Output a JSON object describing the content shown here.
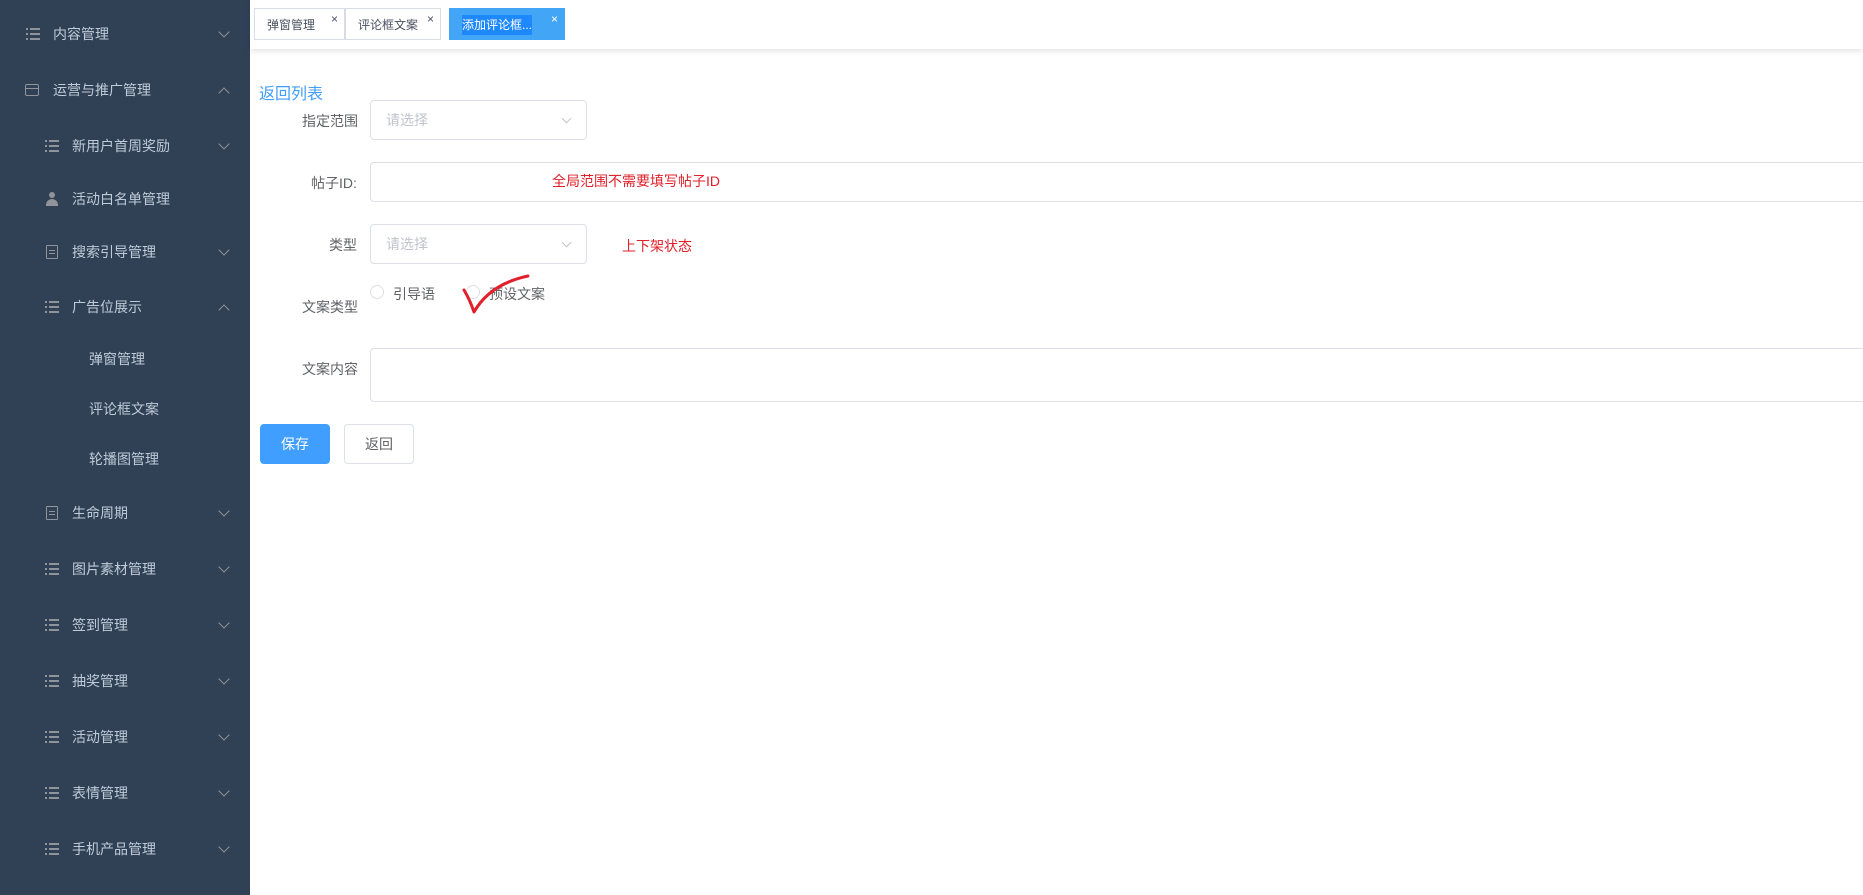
{
  "sidebar": {
    "items": [
      {
        "label": "内容管理",
        "icon": "list-icon"
      },
      {
        "label": "运营与推广管理",
        "icon": "card-icon"
      },
      {
        "label": "新用户首周奖励",
        "icon": "list-icon"
      },
      {
        "label": "活动白名单管理",
        "icon": "user-icon"
      },
      {
        "label": "搜索引导管理",
        "icon": "document-icon"
      },
      {
        "label": "广告位展示",
        "icon": "list-icon"
      },
      {
        "label": "弹窗管理"
      },
      {
        "label": "评论框文案"
      },
      {
        "label": "轮播图管理"
      },
      {
        "label": "生命周期",
        "icon": "document-icon"
      },
      {
        "label": "图片素材管理",
        "icon": "list-icon"
      },
      {
        "label": "签到管理",
        "icon": "list-icon"
      },
      {
        "label": "抽奖管理",
        "icon": "list-icon"
      },
      {
        "label": "活动管理",
        "icon": "list-icon"
      },
      {
        "label": "表情管理",
        "icon": "list-icon"
      },
      {
        "label": "手机产品管理",
        "icon": "list-icon"
      }
    ]
  },
  "tags": [
    {
      "label": "弹窗管理",
      "close": "×"
    },
    {
      "label": "评论框文案",
      "close": "×"
    },
    {
      "label": "添加评论框...",
      "close": "×",
      "active": true
    }
  ],
  "form": {
    "back_link": "返回列表",
    "scope": {
      "label": "指定范围",
      "placeholder": "请选择"
    },
    "post_id": {
      "label": "帖子ID:",
      "note": "全局范围不需要填写帖子ID"
    },
    "type": {
      "label": "类型",
      "placeholder": "请选择",
      "note": "上下架状态"
    },
    "copy_type": {
      "label": "文案类型",
      "options": [
        "引导语",
        "预设文案"
      ]
    },
    "content": {
      "label": "文案内容"
    },
    "save_button": "保存",
    "back_button": "返回"
  },
  "colors": {
    "sidebar_bg": "#304156",
    "primary": "#409eff",
    "annotation_red": "#e0202a"
  }
}
